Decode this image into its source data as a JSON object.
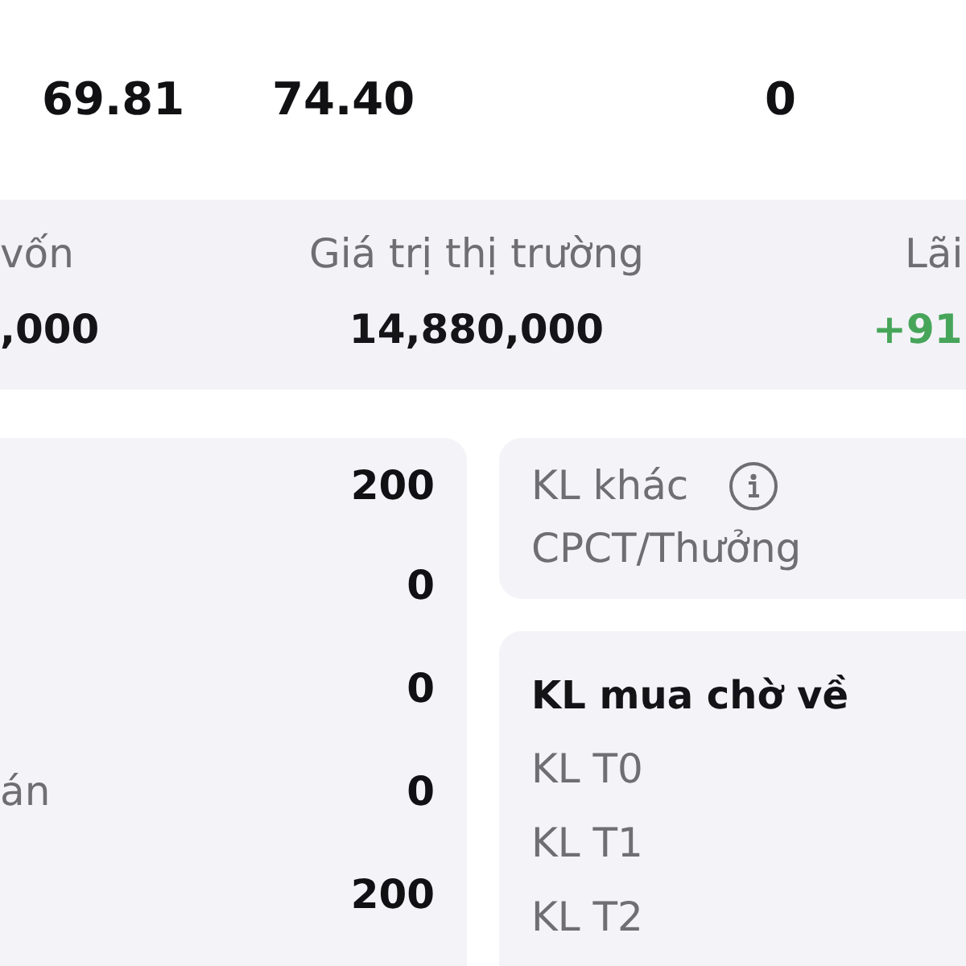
{
  "top_row": {
    "values": [
      "69.81",
      "74.40",
      "0"
    ]
  },
  "summary": {
    "items": [
      {
        "label": "vốn",
        "value": ",000",
        "color": "#151518"
      },
      {
        "label": "Giá trị thị trường",
        "value": "14,880,000",
        "color": "#151518"
      },
      {
        "label": "Lãi",
        "value": "+91",
        "color": "#47a55a"
      }
    ]
  },
  "holdings_card": {
    "rows": [
      {
        "value": "200"
      },
      {
        "value": "0"
      },
      {
        "value": "0"
      },
      {
        "label": "án",
        "value": "0"
      },
      {
        "value": "200"
      }
    ]
  },
  "other_volume_card": {
    "title": "KL khác",
    "subtitle": "CPCT/Thưởng"
  },
  "pending_buy_card": {
    "title": "KL mua chờ về",
    "rows": [
      "KL T0",
      "KL T1",
      "KL T2"
    ]
  }
}
